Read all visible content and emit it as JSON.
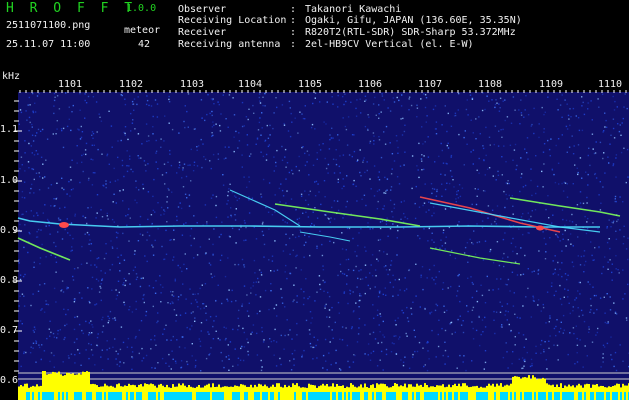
{
  "header": {
    "app_name": "H R O F F T",
    "version": "1.0.0",
    "filename": "2511071100.png",
    "datetime": "25.11.07 11:00",
    "meteor_label": "meteor",
    "meteor_count": "42"
  },
  "info": [
    {
      "key": "Observer",
      "sep": ":",
      "value": "Takanori Kawachi"
    },
    {
      "key": "Receiving Location",
      "sep": ":",
      "value": "Ogaki, Gifu, JAPAN (136.60E, 35.35N)"
    },
    {
      "key": "Receiver",
      "sep": ":",
      "value": "R820T2(RTL-SDR) SDR-Sharp 53.372MHz"
    },
    {
      "key": "Receiving antenna",
      "sep": ":",
      "value": "2el-HB9CV Vertical (el. E-W)"
    }
  ],
  "spectrogram": {
    "y_unit": "kHz",
    "time_labels": [
      "1101",
      "1102",
      "1103",
      "1104",
      "1105",
      "1106",
      "1107",
      "1108",
      "1109",
      "1110"
    ],
    "freq_labels": [
      "1.1",
      "1.0",
      "0.9",
      "0.8",
      "0.7",
      "0.6"
    ],
    "colors": {
      "background": "#10106a",
      "noise_low": "#1d3fd0",
      "noise_high": "#8fc0ff",
      "trace_cyan": "#4ee0ff",
      "trace_green": "#7cff5a",
      "trace_red": "#ff4a4a",
      "level_yellow": "#ffff00",
      "level_cyan": "#00d8ff",
      "label_green": "#21d321",
      "label_white": "#f2f2f2"
    }
  }
}
